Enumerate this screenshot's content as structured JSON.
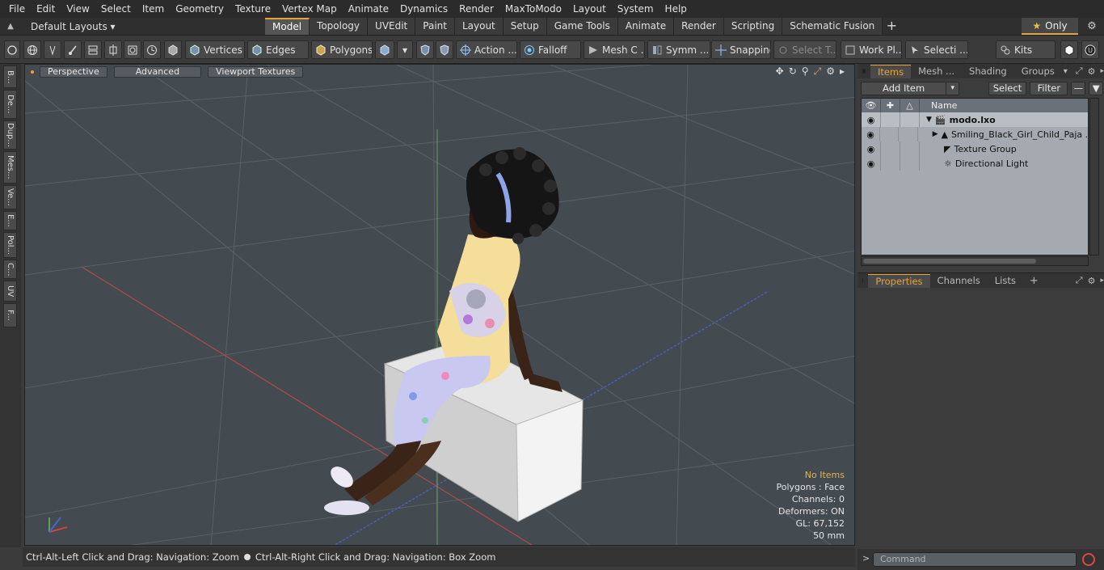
{
  "menu": [
    "File",
    "Edit",
    "View",
    "Select",
    "Item",
    "Geometry",
    "Texture",
    "Vertex Map",
    "Animate",
    "Dynamics",
    "Render",
    "MaxToModo",
    "Layout",
    "System",
    "Help"
  ],
  "layout": {
    "dropdown": "Default Layouts",
    "tabs": [
      "Model",
      "Topology",
      "UVEdit",
      "Paint",
      "Layout",
      "Setup",
      "Game Tools",
      "Animate",
      "Render",
      "Scripting",
      "Schematic Fusion"
    ],
    "active_tab": "Model",
    "only_label": "Only"
  },
  "toolbar": {
    "vertices": "Vertices",
    "edges": "Edges",
    "polygons": "Polygons",
    "action": "Action ...",
    "falloff": "Falloff",
    "mesh": "Mesh C ...",
    "symm": "Symm ...",
    "snapping": "Snapping",
    "select_t": "Select T...",
    "workpl": "Work Pl...",
    "selecti": "Selecti ...",
    "kits": "Kits"
  },
  "left_tabs": [
    "B...",
    "De...",
    "Dup...",
    "Mes...",
    "Ve...",
    "E...",
    "Pol...",
    "C...",
    "UV",
    "F..."
  ],
  "viewport": {
    "perspective": "Perspective",
    "advanced": "Advanced",
    "textures": "Viewport Textures",
    "stats": {
      "no_items": "No Items",
      "polygons": "Polygons : Face",
      "channels": "Channels: 0",
      "deformers": "Deformers: ON",
      "gl": "GL: 67,152",
      "unit": "50 mm"
    }
  },
  "status": {
    "left": "Ctrl-Alt-Left Click and Drag: Navigation: Zoom",
    "right": "Ctrl-Alt-Right Click and Drag: Navigation: Box Zoom"
  },
  "items_panel": {
    "tabs": [
      "Items",
      "Mesh ...",
      "Shading",
      "Groups"
    ],
    "add_item": "Add Item",
    "select": "Select",
    "filter": "Filter",
    "name_header": "Name",
    "rows": [
      {
        "name": "modo.lxo",
        "bold": true
      },
      {
        "name": "Smiling_Black_Girl_Child_Paja ..."
      },
      {
        "name": "Texture Group"
      },
      {
        "name": "Directional Light"
      }
    ]
  },
  "props_panel": {
    "tabs": [
      "Properties",
      "Channels",
      "Lists"
    ]
  },
  "command": {
    "placeholder": "Command"
  }
}
